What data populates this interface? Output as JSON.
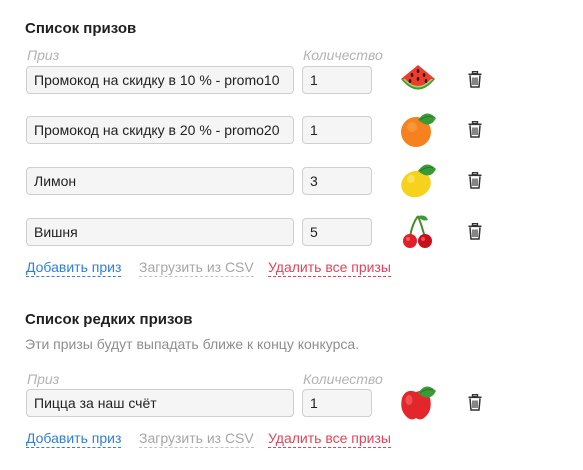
{
  "prizes": {
    "title": "Список призов",
    "col_prize": "Приз",
    "col_qty": "Количество",
    "rows": [
      {
        "name": "Промокод на скидку в 10 % - promo10",
        "qty": "1",
        "icon": "watermelon-icon"
      },
      {
        "name": "Промокод на скидку в 20 % - promo20",
        "qty": "1",
        "icon": "orange-icon"
      },
      {
        "name": "Лимон",
        "qty": "3",
        "icon": "lemon-icon"
      },
      {
        "name": "Вишня",
        "qty": "5",
        "icon": "cherry-icon"
      }
    ],
    "add_label": "Добавить приз",
    "csv_label": "Загрузить из CSV",
    "delete_all_label": "Удалить все призы"
  },
  "rare": {
    "title": "Список редких призов",
    "description": "Эти призы будут выпадать ближе к концу конкурса.",
    "col_prize": "Приз",
    "col_qty": "Количество",
    "rows": [
      {
        "name": "Пицца за наш счёт",
        "qty": "1",
        "icon": "apple-icon"
      }
    ],
    "add_label": "Добавить приз",
    "csv_label": "Загрузить из CSV",
    "delete_all_label": "Удалить все призы"
  },
  "colors": {
    "link_blue": "#2f7fd8",
    "link_gray": "#a6a6a6",
    "link_red": "#e0445a"
  }
}
